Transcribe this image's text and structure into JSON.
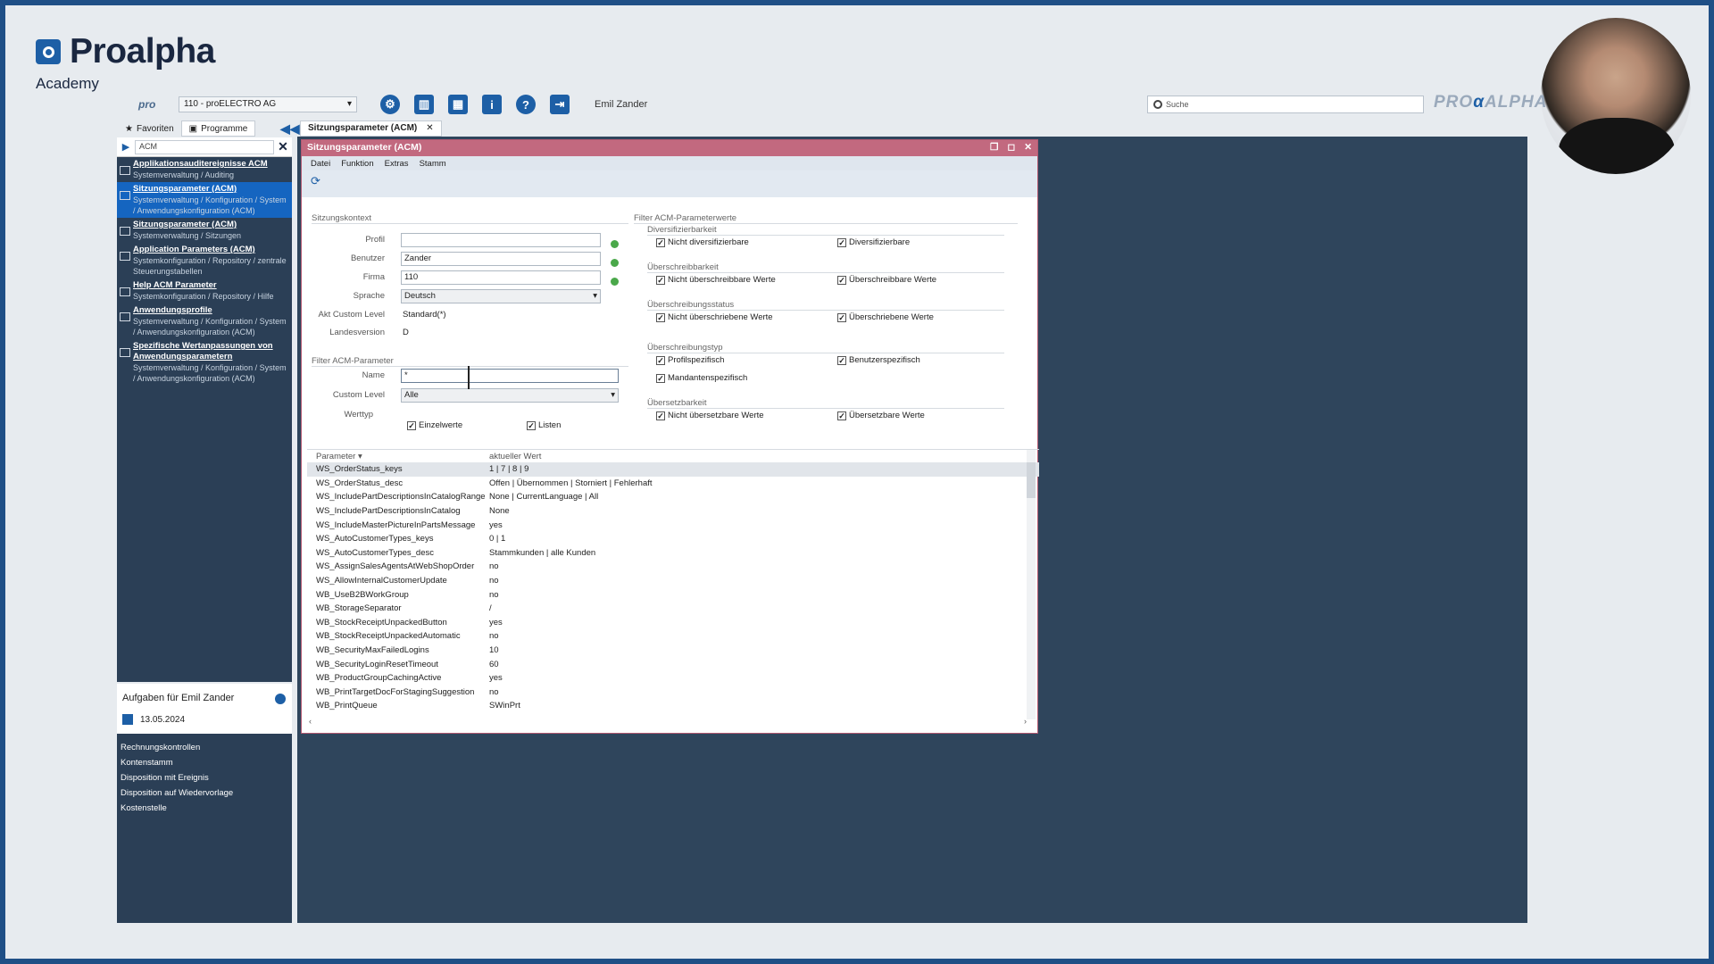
{
  "brand": {
    "name": "Proalpha",
    "sub": "Academy",
    "logo_right": "PRO",
    "logo_right_alpha": "ALPHA",
    "logo_right_symbol": "α"
  },
  "toolbar": {
    "pro_label": "pro",
    "company": "110 - proELECTRO AG",
    "user": "Emil Zander",
    "search_placeholder": "Suche",
    "icons": [
      "gear-icon",
      "panel-icon",
      "layout-icon",
      "info-icon",
      "help-icon",
      "exit-icon"
    ]
  },
  "lefttabs": {
    "favorites": "Favoriten",
    "programs": "Programme",
    "collapse": "◀◀"
  },
  "app_tab": {
    "label": "Sitzungsparameter (ACM)",
    "close": "✕"
  },
  "program_search": {
    "value": "ACM"
  },
  "programs": [
    {
      "title": "Applikationsauditereignisse ACM",
      "path": "Systemverwaltung / Auditing",
      "selected": false
    },
    {
      "title": "Sitzungsparameter (ACM)",
      "path": "Systemverwaltung / Konfiguration / System / Anwendungskonfiguration (ACM)",
      "selected": true
    },
    {
      "title": "Sitzungsparameter (ACM)",
      "path": "Systemverwaltung / Sitzungen",
      "selected": false
    },
    {
      "title": "Application Parameters (ACM)",
      "path": "Systemkonfiguration / Repository / zentrale Steuerungstabellen",
      "selected": false
    },
    {
      "title": "Help ACM Parameter",
      "path": "Systemkonfiguration / Repository / Hilfe",
      "selected": false
    },
    {
      "title": "Anwendungsprofile",
      "path": "Systemverwaltung / Konfiguration / System / Anwendungskonfiguration (ACM)",
      "selected": false
    },
    {
      "title": "Spezifische Wertanpassungen von Anwendungsparametern",
      "path": "Systemverwaltung / Konfiguration / System / Anwendungskonfiguration (ACM)",
      "selected": false
    }
  ],
  "tasks": {
    "title": "Aufgaben für Emil Zander",
    "date": "13.05.2024",
    "items": [
      "Rechnungskontrollen",
      "Kontenstamm",
      "Disposition mit Ereignis",
      "Disposition auf Wiedervorlage",
      "Kostenstelle"
    ]
  },
  "window": {
    "title": "Sitzungsparameter (ACM)",
    "controls": [
      "❐",
      "◻",
      "✕"
    ],
    "menu": [
      "Datei",
      "Funktion",
      "Extras",
      "Stamm"
    ],
    "refresh": "⟳",
    "session_group": "Sitzungskontext",
    "profil_label": "Profil",
    "profil_value": "",
    "benutzer_label": "Benutzer",
    "benutzer_value": "Zander",
    "firma_label": "Firma",
    "firma_value": "110",
    "sprache_label": "Sprache",
    "sprache_value": "Deutsch",
    "akt_label": "Akt Custom Level",
    "akt_value": "Standard(*)",
    "landesversion_label": "Landesversion",
    "landesversion_value": "D",
    "filter_param_group": "Filter ACM-Parameter",
    "name_label": "Name",
    "name_value": "*",
    "custom_label": "Custom Level",
    "custom_value": "Alle",
    "werttyp_label": "Werttyp",
    "einzelwerte": "Einzelwerte",
    "listen": "Listen",
    "filter_values_group": "Filter ACM-Parameterwerte",
    "groups": [
      {
        "title": "Diversifizierbarkeit",
        "a": "Nicht diversifizierbare",
        "b": "Diversifizierbare"
      },
      {
        "title": "Überschreibbarkeit",
        "a": "Nicht überschreibbare Werte",
        "b": "Überschreibbare Werte"
      },
      {
        "title": "Überschreibungsstatus",
        "a": "Nicht überschriebene Werte",
        "b": "Überschriebene Werte"
      },
      {
        "title": "Überschreibungstyp",
        "a": "Profilspezifisch",
        "b": "Benutzerspezifisch",
        "c": "Mandantenspezifisch"
      },
      {
        "title": "Übersetzbarkeit",
        "a": "Nicht übersetzbare Werte",
        "b": "Übersetzbare Werte"
      }
    ],
    "grid_headers": [
      "Parameter",
      "aktueller Wert"
    ],
    "rows": [
      [
        "WS_OrderStatus_keys",
        "1 | 7 | 8 | 9"
      ],
      [
        "WS_OrderStatus_desc",
        "Offen | Übernommen | Storniert | Fehlerhaft"
      ],
      [
        "WS_IncludePartDescriptionsInCatalogRange",
        "None | CurrentLanguage | All"
      ],
      [
        "WS_IncludePartDescriptionsInCatalog",
        "None"
      ],
      [
        "WS_IncludeMasterPictureInPartsMessage",
        "yes"
      ],
      [
        "WS_AutoCustomerTypes_keys",
        "0 | 1"
      ],
      [
        "WS_AutoCustomerTypes_desc",
        "Stammkunden | alle Kunden"
      ],
      [
        "WS_AssignSalesAgentsAtWebShopOrder",
        "no"
      ],
      [
        "WS_AllowInternalCustomerUpdate",
        "no"
      ],
      [
        "WB_UseB2BWorkGroup",
        "no"
      ],
      [
        "WB_StorageSeparator",
        "/"
      ],
      [
        "WB_StockReceiptUnpackedButton",
        "yes"
      ],
      [
        "WB_StockReceiptUnpackedAutomatic",
        "no"
      ],
      [
        "WB_SecurityMaxFailedLogins",
        "10"
      ],
      [
        "WB_SecurityLoginResetTimeout",
        "60"
      ],
      [
        "WB_ProductGroupCachingActive",
        "yes"
      ],
      [
        "WB_PrintTargetDocForStagingSuggestion",
        "no"
      ],
      [
        "WB_PrintQueue",
        "SWinPrt"
      ]
    ]
  }
}
